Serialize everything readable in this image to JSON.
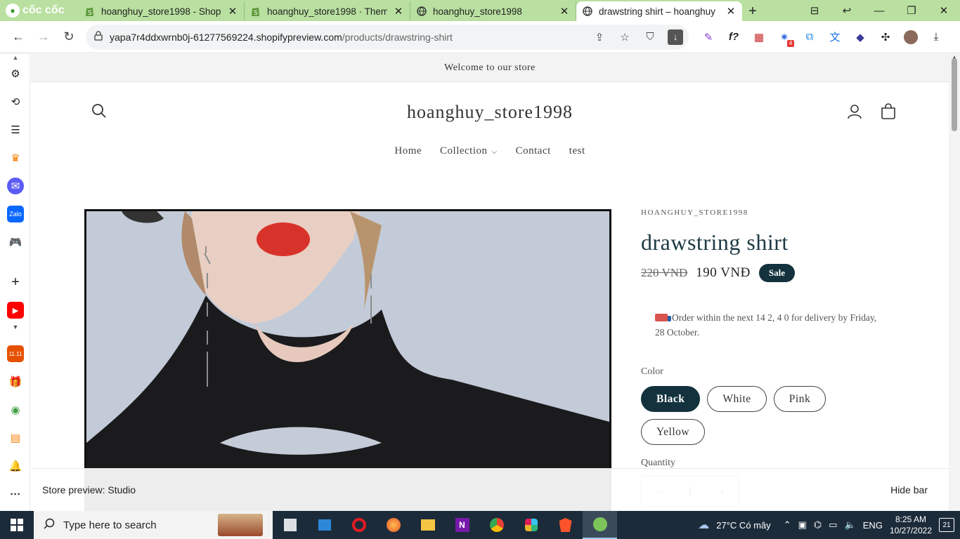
{
  "browser": {
    "brand": "cốc cốc",
    "tabs": [
      {
        "title": "hoanghuy_store1998 - Shop",
        "active": false
      },
      {
        "title": "hoanghuy_store1998 · Them",
        "active": false
      },
      {
        "title": "hoanghuy_store1998",
        "active": false
      },
      {
        "title": "drawstring shirt – hoanghuy",
        "active": true
      }
    ],
    "url_host": "yapa7r4ddxwrnb0j-61277569224.shopifypreview.com",
    "url_path": "/products/drawstring-shirt",
    "ext_badge": "4"
  },
  "store": {
    "announcement": "Welcome to our store",
    "name": "hoanghuy_store1998",
    "menu": [
      "Home",
      "Collection",
      "Contact",
      "test"
    ]
  },
  "product": {
    "vendor": "HOANGHUY_STORE1998",
    "title": "drawstring shirt",
    "old_price": "220 VNĐ",
    "price": "190 VNĐ",
    "badge": "Sale",
    "delivery": "Order within the next 14 2, 4 0 for delivery by Friday, 28 October.",
    "color_label": "Color",
    "colors": [
      "Black",
      "White",
      "Pink",
      "Yellow"
    ],
    "selected_color": "Black",
    "quantity_label": "Quantity",
    "quantity": "1",
    "qty_minus": "−",
    "qty_plus": "+"
  },
  "preview_bar": {
    "label": "Store preview:",
    "theme": "Studio",
    "hide": "Hide bar"
  },
  "taskbar": {
    "search_placeholder": "Type here to search",
    "weather": "27°C  Có mây",
    "lang": "ENG",
    "time": "8:25 AM",
    "date": "10/27/2022",
    "notifications": "21"
  },
  "colors": {
    "accent": "#13323e",
    "tab_strip": "#b9e0a0",
    "taskbar": "#1c2b3a"
  }
}
